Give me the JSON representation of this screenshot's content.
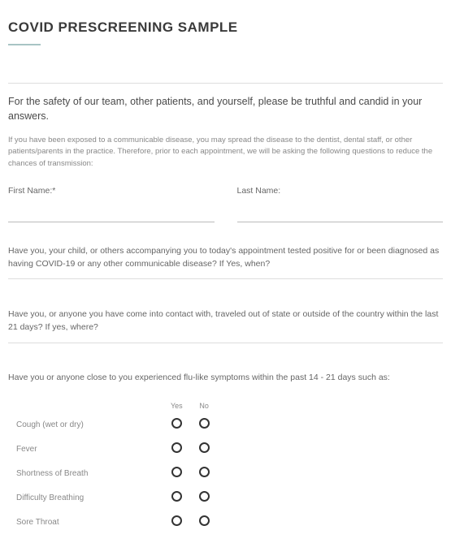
{
  "title": "COVID PRESCREENING SAMPLE",
  "intro": "For the safety of our team, other patients, and yourself, please be truthful and candid in your answers.",
  "notice": "If you have been exposed to a communicable disease, you may spread the disease to the dentist, dental staff, or other patients/parents in the practice. Therefore, prior to each appointment, we will be asking the following questions to reduce the chances of transmission:",
  "firstNameLabel": "First Name:*",
  "lastNameLabel": "Last Name:",
  "q1": "Have you, your child, or others accompanying you to today's appointment tested positive for or been diagnosed as having COVID-19 or any other communicable disease? If Yes, when?",
  "q2": "Have you, or anyone you have come into contact with, traveled out of state or outside of the country within the last 21 days? If yes, where?",
  "symptomIntro": "Have you or anyone close to you experienced flu-like symptoms within the past 14 - 21 days such as:",
  "headers": {
    "yes": "Yes",
    "no": "No"
  },
  "symptoms": [
    "Cough (wet or dry)",
    "Fever",
    "Shortness of Breath",
    "Difficulty Breathing",
    "Sore Throat"
  ]
}
